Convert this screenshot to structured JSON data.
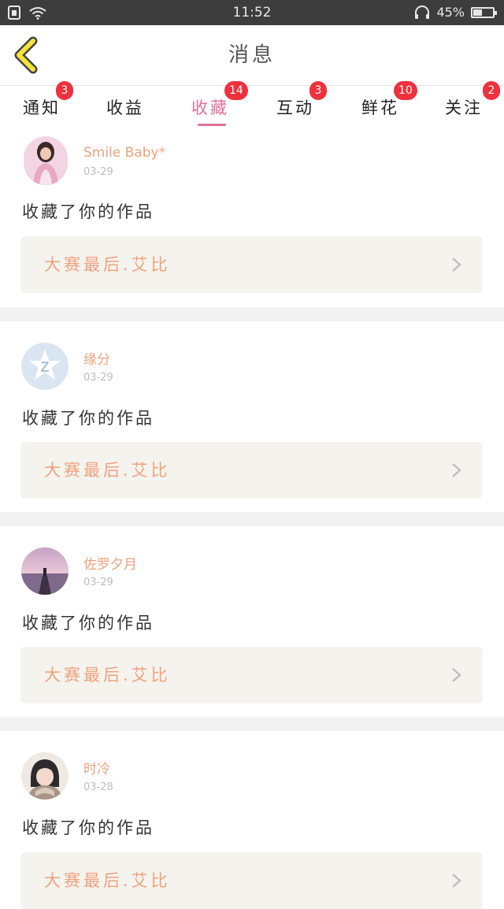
{
  "status_bar": {
    "time": "11:52",
    "battery_text": "45%",
    "battery_level": 0.45
  },
  "header": {
    "title": "消息"
  },
  "tabs": [
    {
      "label": "通知",
      "badge": "3",
      "active": false
    },
    {
      "label": "收益",
      "badge": "",
      "active": false
    },
    {
      "label": "收藏",
      "badge": "14",
      "active": true
    },
    {
      "label": "互动",
      "badge": "3",
      "active": false
    },
    {
      "label": "鲜花",
      "badge": "10",
      "active": false
    },
    {
      "label": "关注",
      "badge": "2",
      "active": false
    }
  ],
  "feed": [
    {
      "user": "Smile Baby*",
      "date": "03-29",
      "action": "收藏了你的作品",
      "work_title": "大赛最后.艾比"
    },
    {
      "user": "缘分",
      "date": "03-29",
      "action": "收藏了你的作品",
      "work_title": "大赛最后.艾比"
    },
    {
      "user": "佐罗夕月",
      "date": "03-29",
      "action": "收藏了你的作品",
      "work_title": "大赛最后.艾比"
    },
    {
      "user": "时冷",
      "date": "03-28",
      "action": "收藏了你的作品",
      "work_title": "大赛最后.艾比"
    }
  ],
  "colors": {
    "accent": "#e0719a",
    "username": "#f0a27d",
    "badge": "#f0303c",
    "status_bar": "#3d3d3d",
    "link_bg": "#f4f3ee",
    "back_arrow": "#f5e23a"
  }
}
